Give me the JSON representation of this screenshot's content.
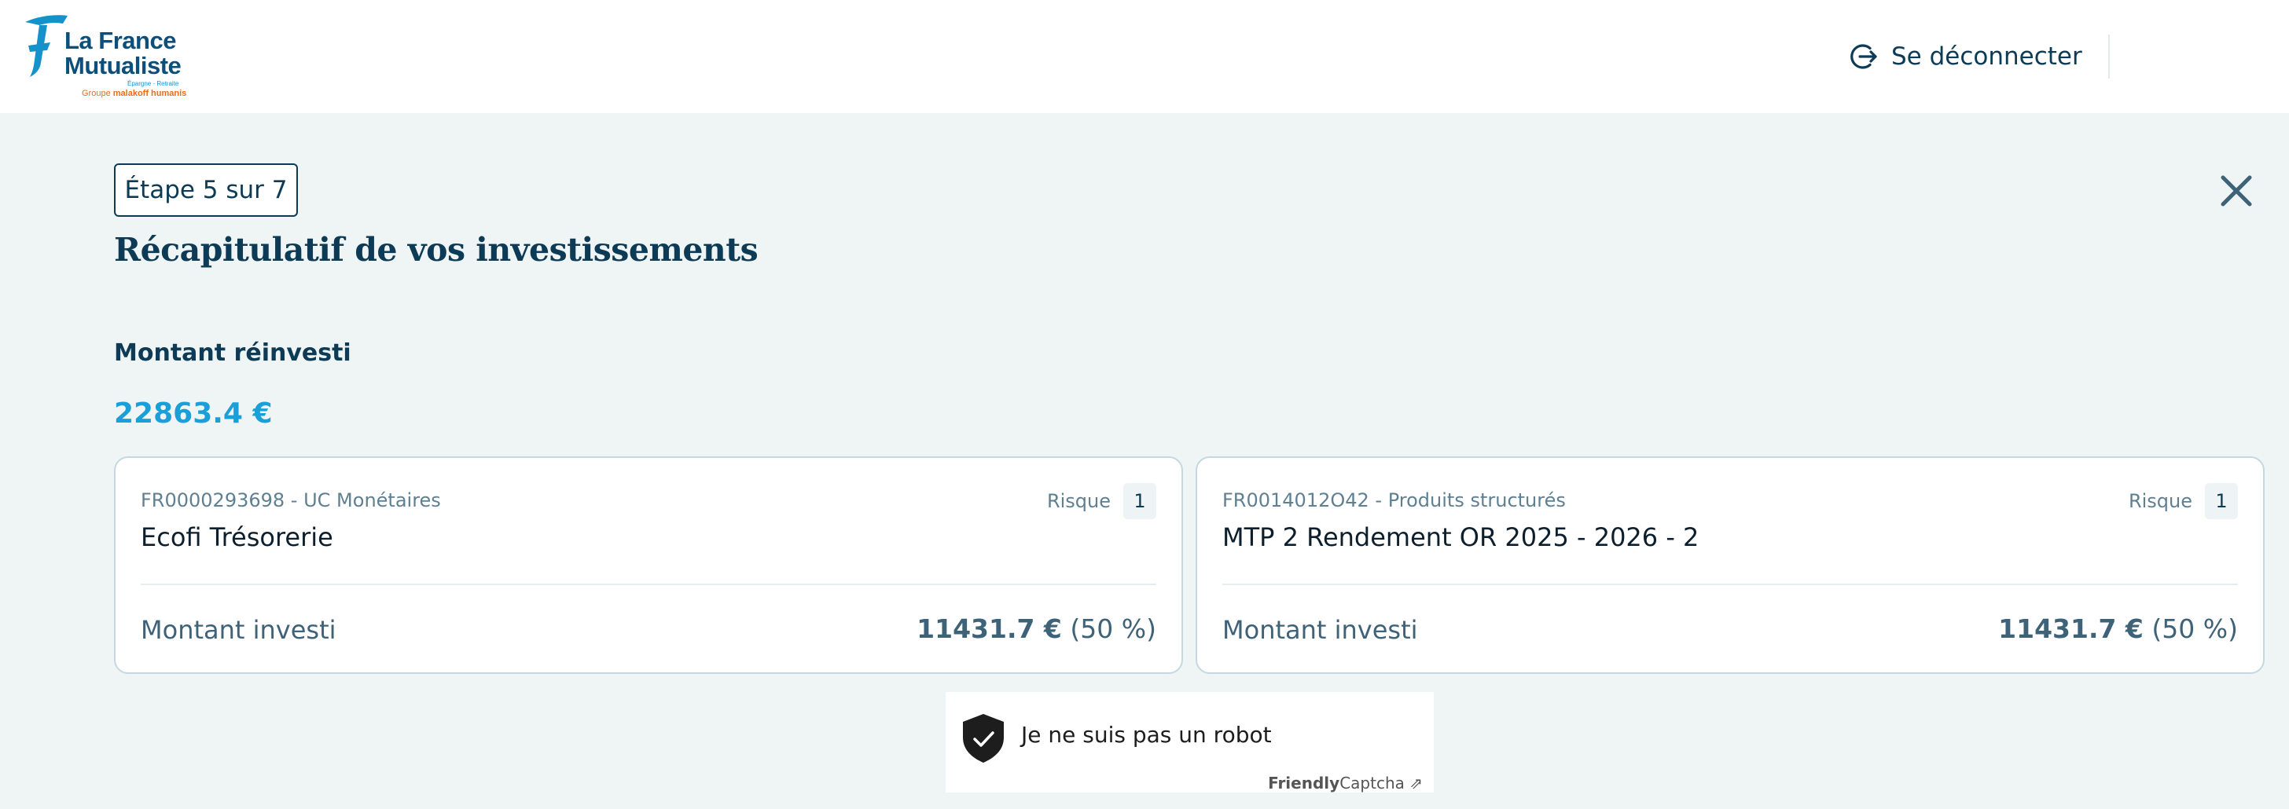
{
  "header": {
    "logo": {
      "line1": "La France",
      "line2": "Mutualiste",
      "tagline": "Épargne · Retraite",
      "group_prefix": "Groupe ",
      "group_name": "malakoff humanis"
    },
    "logout_label": "Se déconnecter",
    "logout_icon": "logout-icon"
  },
  "step_label": "Étape 5 sur 7",
  "close_icon": "close-icon",
  "title": "Récapitulatif de vos investissements",
  "reinvested": {
    "label": "Montant réinvesti",
    "amount": "22863.4 €"
  },
  "cards": [
    {
      "code": "FR0000293698 - UC Monétaires",
      "risk_label": "Risque",
      "risk_value": "1",
      "name": "Ecofi Trésorerie",
      "invest_label": "Montant investi",
      "invest_amount": "11431.7 €",
      "invest_share": "(50 %)"
    },
    {
      "code": "FR0014012O42 - Produits structurés",
      "risk_label": "Risque",
      "risk_value": "1",
      "name": "MTP 2 Rendement OR 2025 - 2026 - 2",
      "invest_label": "Montant investi",
      "invest_amount": "11431.7 €",
      "invest_share": "(50 %)"
    }
  ],
  "captcha": {
    "label": "Je ne suis pas un robot",
    "brand_bold": "Friendly",
    "brand_rest": "Captcha",
    "brand_arrow": "⇗",
    "icon": "shield-check-icon"
  },
  "colors": {
    "primary": "#0d3b56",
    "accent": "#1a9fd9",
    "background": "#eff4f5",
    "logo_orange": "#ec6c1b"
  }
}
